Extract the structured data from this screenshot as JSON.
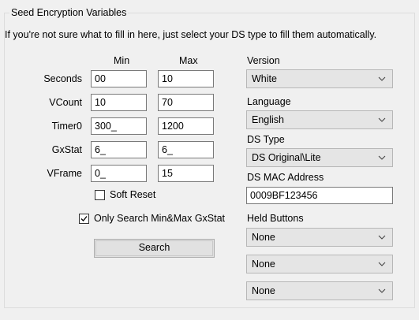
{
  "group": {
    "title": "Seed Encryption Variables",
    "hint": "If you're not sure what to fill in here, just select your DS type to fill them automatically."
  },
  "headers": {
    "min": "Min",
    "max": "Max"
  },
  "rows": [
    {
      "label": "Seconds",
      "min": "00",
      "max": "10"
    },
    {
      "label": "VCount",
      "min": "10",
      "max": "70"
    },
    {
      "label": "Timer0",
      "min": "300_",
      "max": "1200"
    },
    {
      "label": "GxStat",
      "min": "6_",
      "max": "6_"
    },
    {
      "label": "VFrame",
      "min": "0_",
      "max": "15"
    }
  ],
  "soft_reset": {
    "label": "Soft Reset",
    "checked": false
  },
  "only_search": {
    "label": "Only Search Min&Max GxStat",
    "checked": true
  },
  "search_button": "Search",
  "version": {
    "label": "Version",
    "value": "White"
  },
  "language": {
    "label": "Language",
    "value": "English"
  },
  "ds_type": {
    "label": "DS Type",
    "value": "DS Original\\Lite"
  },
  "mac": {
    "label": "DS MAC Address",
    "value": "0009BF123456"
  },
  "held_buttons": {
    "label": "Held Buttons",
    "values": [
      "None",
      "None",
      "None"
    ]
  },
  "icons": {
    "dropdown": "chevron-down-icon",
    "check": "checkmark-icon"
  },
  "colors": {
    "panel": "#f0f0f0",
    "dropdown_bg": "#e5e5e5",
    "button_bg": "#e1e1e1"
  }
}
